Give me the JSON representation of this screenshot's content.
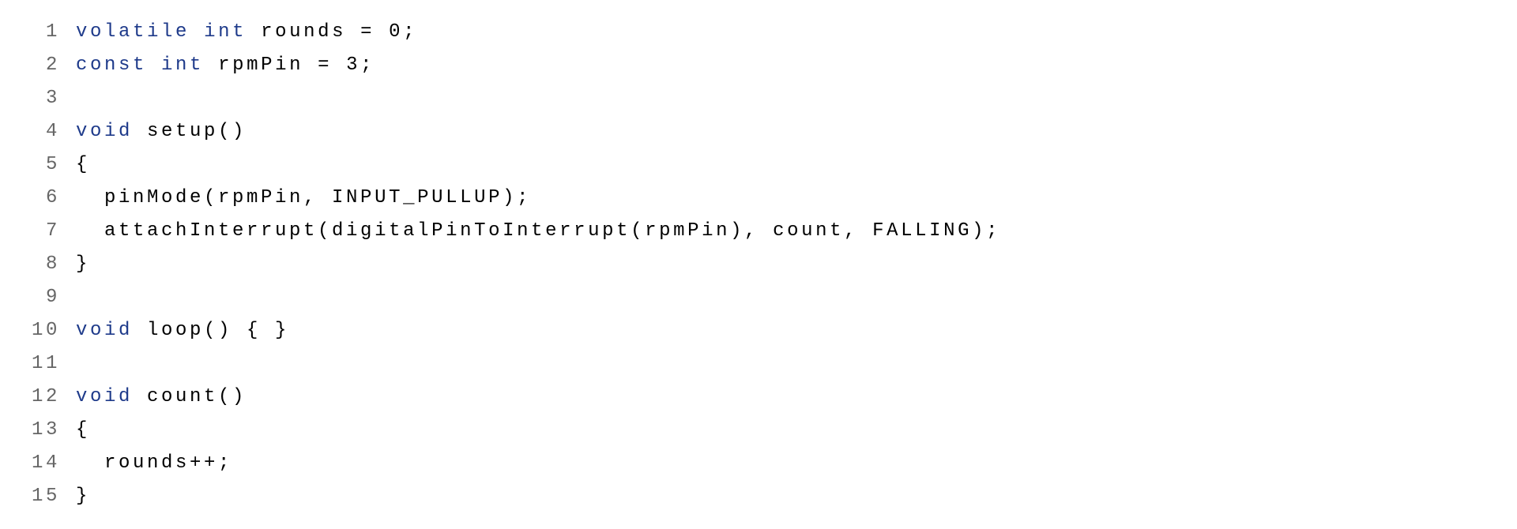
{
  "code": {
    "lines": [
      {
        "num": "1",
        "tokens": [
          {
            "text": "volatile",
            "class": "keyword"
          },
          {
            "text": " ",
            "class": ""
          },
          {
            "text": "int",
            "class": "type"
          },
          {
            "text": " rounds = 0;",
            "class": ""
          }
        ]
      },
      {
        "num": "2",
        "tokens": [
          {
            "text": "const",
            "class": "keyword"
          },
          {
            "text": " ",
            "class": ""
          },
          {
            "text": "int",
            "class": "type"
          },
          {
            "text": " rpmPin = 3;",
            "class": ""
          }
        ]
      },
      {
        "num": "3",
        "tokens": []
      },
      {
        "num": "4",
        "tokens": [
          {
            "text": "void",
            "class": "type"
          },
          {
            "text": " setup()",
            "class": ""
          }
        ]
      },
      {
        "num": "5",
        "tokens": [
          {
            "text": "{",
            "class": ""
          }
        ]
      },
      {
        "num": "6",
        "tokens": [
          {
            "text": "  pinMode(rpmPin, INPUT_PULLUP);",
            "class": ""
          }
        ]
      },
      {
        "num": "7",
        "tokens": [
          {
            "text": "  attachInterrupt(digitalPinToInterrupt(rpmPin), count, FALLING);",
            "class": ""
          }
        ]
      },
      {
        "num": "8",
        "tokens": [
          {
            "text": "}",
            "class": ""
          }
        ]
      },
      {
        "num": "9",
        "tokens": []
      },
      {
        "num": "10",
        "tokens": [
          {
            "text": "void",
            "class": "type"
          },
          {
            "text": " loop() { }",
            "class": ""
          }
        ]
      },
      {
        "num": "11",
        "tokens": []
      },
      {
        "num": "12",
        "tokens": [
          {
            "text": "void",
            "class": "type"
          },
          {
            "text": " count()",
            "class": ""
          }
        ]
      },
      {
        "num": "13",
        "tokens": [
          {
            "text": "{",
            "class": ""
          }
        ]
      },
      {
        "num": "14",
        "tokens": [
          {
            "text": "  rounds++;",
            "class": ""
          }
        ]
      },
      {
        "num": "15",
        "tokens": [
          {
            "text": "}",
            "class": ""
          }
        ]
      }
    ]
  }
}
